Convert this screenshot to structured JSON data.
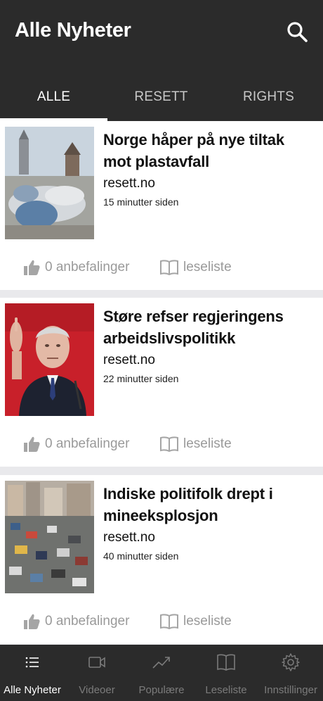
{
  "header": {
    "title": "Alle Nyheter",
    "search_icon": "search-icon"
  },
  "tabs": [
    {
      "label": "ALLE",
      "active": true
    },
    {
      "label": "RESETT",
      "active": false
    },
    {
      "label": "RIGHTS",
      "active": false
    }
  ],
  "articles": [
    {
      "headline": "Norge håper på nye tiltak mot plastavfall",
      "source": "resett.no",
      "time": "15 minutter siden",
      "likes": "0 anbefalinger",
      "reading_list": "leseliste"
    },
    {
      "headline": "Støre refser regjeringens arbeidslivspolitikk",
      "source": "resett.no",
      "time": "22 minutter siden",
      "likes": "0 anbefalinger",
      "reading_list": "leseliste"
    },
    {
      "headline": "Indiske politifolk drept i mineeksplosjon",
      "source": "resett.no",
      "time": "40 minutter siden",
      "likes": "0 anbefalinger",
      "reading_list": "leseliste"
    }
  ],
  "bottom_nav": [
    {
      "label": "Alle Nyheter",
      "icon": "list-icon",
      "active": true
    },
    {
      "label": "Videoer",
      "icon": "video-icon",
      "active": false
    },
    {
      "label": "Populære",
      "icon": "trending-icon",
      "active": false
    },
    {
      "label": "Leseliste",
      "icon": "book-icon",
      "active": false
    },
    {
      "label": "Innstillinger",
      "icon": "gear-icon",
      "active": false
    }
  ],
  "colors": {
    "header_bg": "#2b2b2b",
    "active_text": "#ffffff",
    "inactive_text": "#c8c8c8",
    "action_gray": "#9a9a9a",
    "separator": "#e9e9ec"
  }
}
